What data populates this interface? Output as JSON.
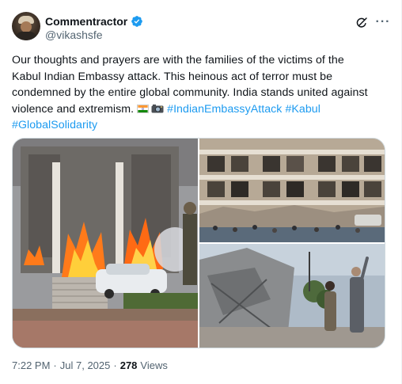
{
  "author": {
    "display_name": "Commentractor",
    "handle": "@vikashsfe",
    "verified": true,
    "verified_color": "#1d9bf0"
  },
  "tweet": {
    "text_lines": [
      "Our thoughts and prayers are with the families of the victims of the",
      "Kabul Indian Embassy attack. This heinous act of terror must be",
      "condemned by the entire global community. India stands united against",
      "violence and extremism."
    ],
    "emojis": [
      "flag-india",
      "camera-with-flash"
    ],
    "hashtags": [
      "#IndianEmbassyAttack",
      "#Kabul",
      "#GlobalSolidarity"
    ],
    "hashtag_color": "#1d9bf0"
  },
  "media": {
    "count": 3,
    "photos": [
      {
        "description_icon": "burning-building-photo"
      },
      {
        "description_icon": "damaged-building-photo"
      },
      {
        "description_icon": "officials-at-rubble-photo"
      }
    ]
  },
  "meta": {
    "time": "7:22 PM",
    "separator": "·",
    "date": "Jul 7, 2025",
    "views_count": "278",
    "views_label": "Views"
  },
  "icons": {
    "grok": "grok-icon",
    "more": "more-icon"
  }
}
